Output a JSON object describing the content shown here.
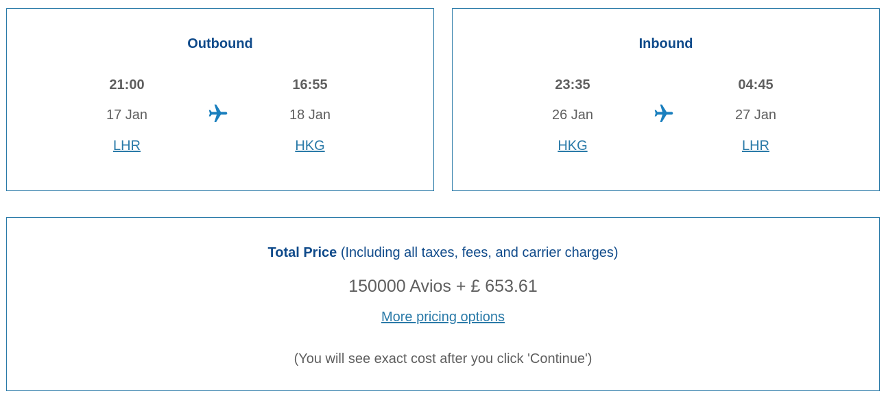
{
  "outbound": {
    "title": "Outbound",
    "depart_time": "21:00",
    "depart_date": "17 Jan",
    "depart_airport": "LHR",
    "arrive_time": "16:55",
    "arrive_date": "18 Jan",
    "arrive_airport": "HKG"
  },
  "inbound": {
    "title": "Inbound",
    "depart_time": "23:35",
    "depart_date": "26 Jan",
    "depart_airport": "HKG",
    "arrive_time": "04:45",
    "arrive_date": "27 Jan",
    "arrive_airport": "LHR"
  },
  "price": {
    "label": "Total Price",
    "label_note": "(Including all taxes, fees, and carrier charges)",
    "amount": "150000 Avios + £ 653.61",
    "more_link": "More pricing options",
    "note": "(You will see exact cost after you click 'Continue')"
  },
  "colors": {
    "border": "#2a7aa8",
    "title": "#0f4a8a",
    "text": "#5f5f5f",
    "link": "#2a7aa8",
    "plane_icon": "#1a7fbe"
  },
  "icons": {
    "plane": "airplane-icon"
  }
}
